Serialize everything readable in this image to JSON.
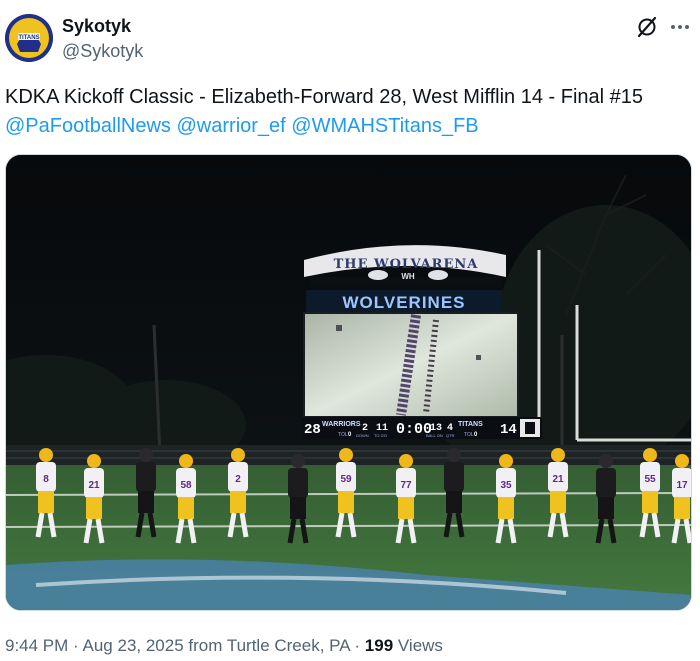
{
  "author": {
    "display_name": "Sykotyk",
    "handle": "@Sykotyk",
    "avatar_text": "TITANS"
  },
  "tweet": {
    "text": "KDKA Kickoff Classic - Elizabeth-Forward 28, West Mifflin 14 - Final #15",
    "mentions": [
      "@PaFootballNews",
      "@warrior_ef",
      "@WMAHSTitans_FB"
    ]
  },
  "media": {
    "scoreboard_title": "THE WOLVARENA",
    "scoreboard_logo": "WH",
    "scoreboard_team_banner": "WOLVERINES",
    "home_score": "28",
    "home_team": "WARRIORS",
    "home_tol": "TOL",
    "home_tol_value": "0",
    "down_label": "DOWN",
    "down_value": "2",
    "to_go_label": "TO GO",
    "to_go_value": "11",
    "clock": "0:00",
    "quarter": "4",
    "ball_on_label": "BALL ON",
    "ball_on_value": "13",
    "qtr_label": "QTR",
    "away_team": "TITANS",
    "away_score": "14",
    "away_tol": "TOL",
    "away_tol_value": "0",
    "home_jerseys": [
      "8",
      "21",
      "58",
      "2",
      "59",
      "77",
      "35",
      "21",
      "55",
      "17",
      "59"
    ],
    "colors": {
      "field": "#3f6f3a",
      "sky": "#0a0e10",
      "home_uniform": "#f2f0f5",
      "home_pants": "#f0c21f",
      "home_helmet": "#f0b71a",
      "away_uniform": "#1c1c1f"
    }
  },
  "meta": {
    "time": "9:44 PM",
    "separator": "·",
    "date": "Aug 23, 2025",
    "location": "from Turtle Creek, PA",
    "views_count": "199",
    "views_label": "Views"
  },
  "icons": {
    "grok": "grok-icon",
    "more": "more-icon"
  }
}
